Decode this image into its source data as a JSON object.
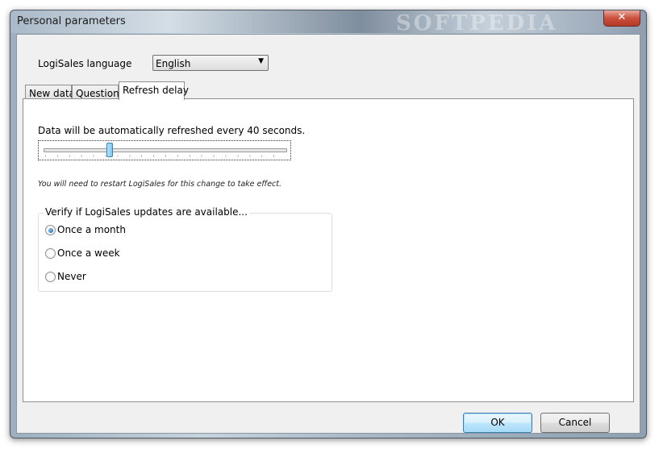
{
  "window": {
    "title": "Personal parameters",
    "watermark": "SOFTPEDIA",
    "close_glyph": "✕"
  },
  "language": {
    "label": "LogiSales language",
    "selected": "English",
    "arrow": "▼"
  },
  "tabs": [
    {
      "label": "New data",
      "active": false
    },
    {
      "label": "Questions",
      "active": false
    },
    {
      "label": "Refresh delay",
      "active": true
    }
  ],
  "refresh": {
    "text": "Data will be automatically refreshed every 40 seconds.",
    "slider_fraction": 0.27,
    "restart_note": "You will need to restart LogiSales for this change to take effect."
  },
  "updates": {
    "label": "Verify if LogiSales updates are available...",
    "options": [
      {
        "label": "Once a month",
        "checked": true
      },
      {
        "label": "Once a week",
        "checked": false
      },
      {
        "label": "Never",
        "checked": false
      }
    ]
  },
  "buttons": {
    "ok": "OK",
    "cancel": "Cancel"
  },
  "colors": {
    "accent": "#3c7fb1",
    "close_button": "#c9503c"
  }
}
